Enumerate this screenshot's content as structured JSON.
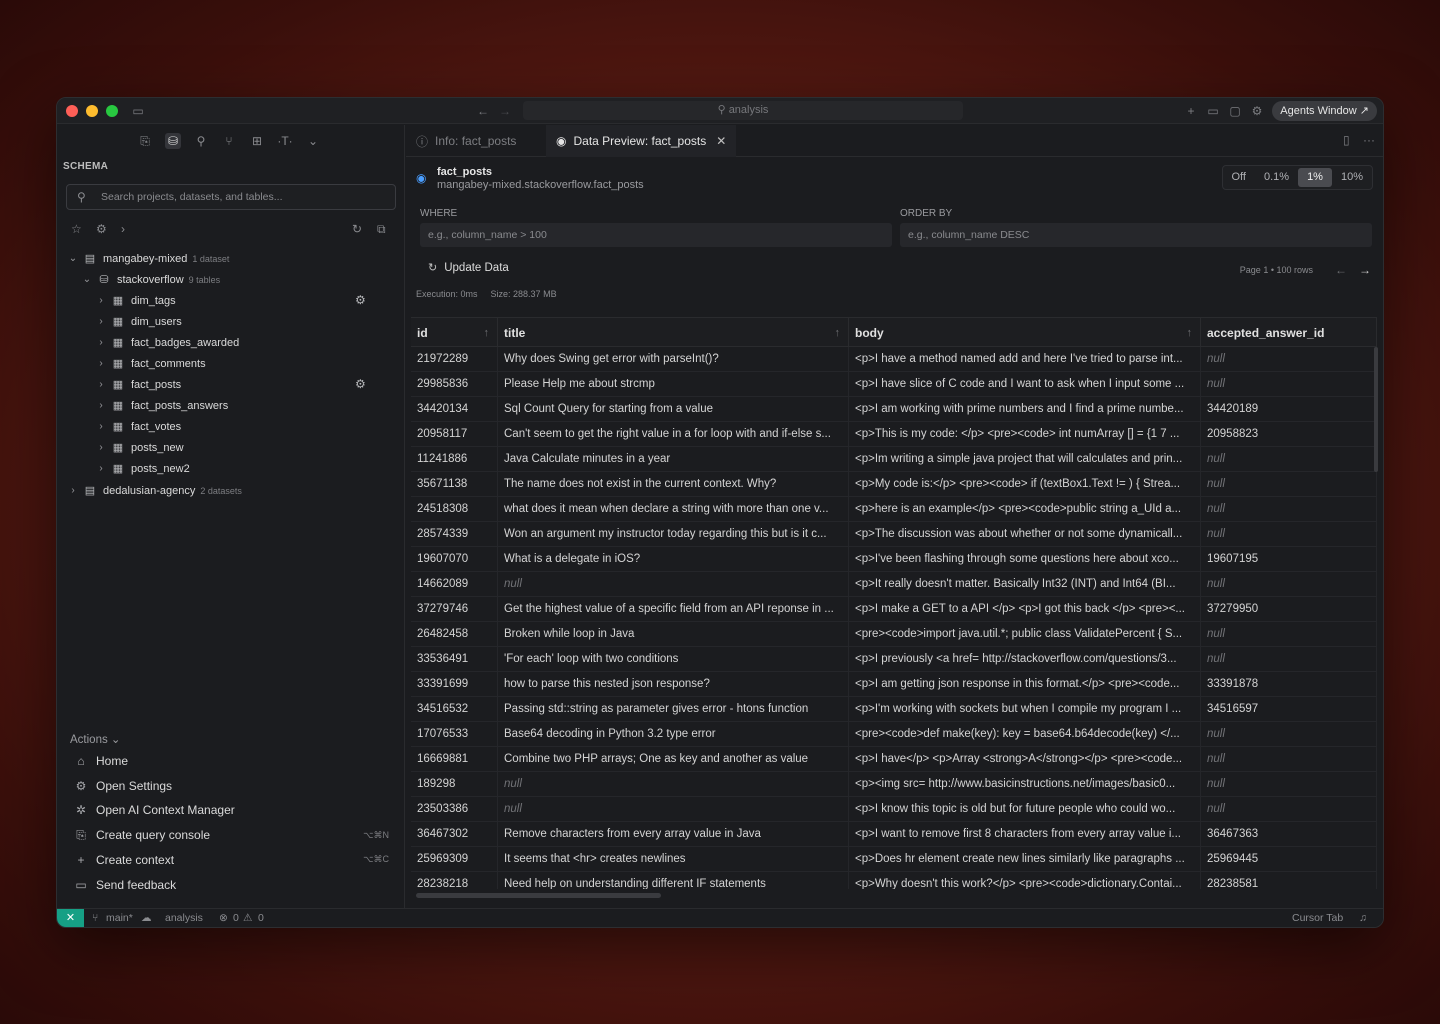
{
  "window": {
    "search_placeholder": "analysis",
    "agents_button": "Agents Window ↗"
  },
  "sidebar": {
    "schema_label": "SCHEMA",
    "search_placeholder": "Search projects, datasets, and tables...",
    "projects": [
      {
        "name": "mangabey-mixed",
        "meta": "1 dataset"
      },
      {
        "name": "dedalusian-agency",
        "meta": "2 datasets"
      }
    ],
    "dataset": {
      "name": "stackoverflow",
      "meta": "9 tables"
    },
    "tables": [
      "dim_tags",
      "dim_users",
      "fact_badges_awarded",
      "fact_comments",
      "fact_posts",
      "fact_posts_answers",
      "fact_votes",
      "posts_new",
      "posts_new2"
    ],
    "actions_header": "Actions ⌄",
    "actions": [
      {
        "label": "Home",
        "icon": "home-icon",
        "kbd": ""
      },
      {
        "label": "Open Settings",
        "icon": "gear-icon",
        "kbd": ""
      },
      {
        "label": "Open AI Context Manager",
        "icon": "ai-icon",
        "kbd": ""
      },
      {
        "label": "Create query console",
        "icon": "console-icon",
        "kbd": "⌥⌘N"
      },
      {
        "label": "Create context",
        "icon": "plus-icon",
        "kbd": "⌥⌘C"
      },
      {
        "label": "Send feedback",
        "icon": "feedback-icon",
        "kbd": ""
      }
    ]
  },
  "tabs": [
    {
      "label": "Info: fact_posts",
      "active": false,
      "icon": "info-icon"
    },
    {
      "label": "Data Preview: fact_posts",
      "active": true,
      "icon": "eye-icon"
    }
  ],
  "preview": {
    "table_name": "fact_posts",
    "table_path": "mangabey-mixed.stackoverflow.fact_posts",
    "sample_options": [
      "Off",
      "0.1%",
      "1%",
      "10%"
    ],
    "sample_selected": "1%",
    "where_label": "WHERE",
    "where_placeholder": "e.g., column_name > 100",
    "order_label": "ORDER BY",
    "order_placeholder": "e.g., column_name DESC",
    "update_label": "Update Data",
    "pager": "Page 1 • 100 rows",
    "execution": "Execution: 0ms",
    "size": "Size: 288.37 MB"
  },
  "grid": {
    "columns": [
      "id",
      "title",
      "body",
      "accepted_answer_id"
    ],
    "rows": [
      [
        "21972289",
        "Why does Swing get error with parseInt()?",
        "<p>I have a method named add and here I've tried to parse int...",
        "null"
      ],
      [
        "29985836",
        "Please Help me about strcmp",
        "<p>I have slice of C code and I want to ask when I input some ...",
        "null"
      ],
      [
        "34420134",
        "Sql Count Query for starting from a value",
        "<p>I am working with prime numbers and I find a prime numbe...",
        "34420189"
      ],
      [
        "20958117",
        "Can't seem to get the right value in a for loop with and if-else s...",
        "<p>This is my code: </p> <pre><code> int numArray [] = {1 7 ...",
        "20958823"
      ],
      [
        "11241886",
        "Java Calculate minutes in a year",
        "<p>Im writing a simple java project that will calculates and prin...",
        "null"
      ],
      [
        "35671138",
        "The name does not exist in the current context. Why?",
        "<p>My code is:</p> <pre><code> if (textBox1.Text != ) { Strea...",
        "null"
      ],
      [
        "24518308",
        "what does it mean when declare a string with more than one v...",
        "<p>here is an example</p> <pre><code>public string a_UId a...",
        "null"
      ],
      [
        "28574339",
        "Won an argument my instructor today regarding this but is it c...",
        "<p>The discussion was about whether or not some dynamicall...",
        "null"
      ],
      [
        "19607070",
        "What is a delegate in iOS?",
        "<p>I've been flashing through some questions here about xco...",
        "19607195"
      ],
      [
        "14662089",
        "null",
        "<p>It really doesn't matter. Basically Int32 (INT) and Int64 (BI...",
        "null"
      ],
      [
        "37279746",
        "Get the highest value of a specific field from an API reponse in ...",
        "<p>I make a GET to a API </p> <p>I got this back </p> <pre><...",
        "37279950"
      ],
      [
        "26482458",
        "Broken while loop in Java",
        "<pre><code>import java.util.*; public class ValidatePercent { S...",
        "null"
      ],
      [
        "33536491",
        "'For each' loop with two conditions",
        "<p>I previously <a href= http://stackoverflow.com/questions/3...",
        "null"
      ],
      [
        "33391699",
        "how to parse this nested json response?",
        "<p>I am getting json response in this format.</p> <pre><code...",
        "33391878"
      ],
      [
        "34516532",
        "Passing std::string as parameter gives error - htons function",
        "<p>I'm working with sockets but when I compile my program I ...",
        "34516597"
      ],
      [
        "17076533",
        "Base64 decoding in Python 3.2 type error",
        "<pre><code>def make(key): key = base64.b64decode(key) </...",
        "null"
      ],
      [
        "16669881",
        "Combine two PHP arrays; One as key and another as value",
        "<p>I have</p> <p>Array <strong>A</strong></p> <pre><code...",
        "null"
      ],
      [
        "189298",
        "null",
        "<p><img src= http://www.basicinstructions.net/images/basic0...",
        "null"
      ],
      [
        "23503386",
        "null",
        "<p>I know this topic is old but for future people who could wo...",
        "null"
      ],
      [
        "36467302",
        "Remove characters from every array value in Java",
        "<p>I want to remove first 8 characters from every array value i...",
        "36467363"
      ],
      [
        "25969309",
        "It seems that <hr> creates newlines",
        "<p>Does hr element create new lines similarly like paragraphs ...",
        "25969445"
      ],
      [
        "28238218",
        "Need help on understanding different IF statements",
        "<p>Why doesn't this work?</p> <pre><code>dictionary.Contai...",
        "28238581"
      ]
    ]
  },
  "statusbar": {
    "branch": "main*",
    "project": "analysis",
    "errors": "0",
    "warnings": "0",
    "right_label": "Cursor Tab"
  },
  "colors": {
    "accent": "#4a9eff",
    "remote": "#16a085",
    "null_text": "#727377"
  }
}
